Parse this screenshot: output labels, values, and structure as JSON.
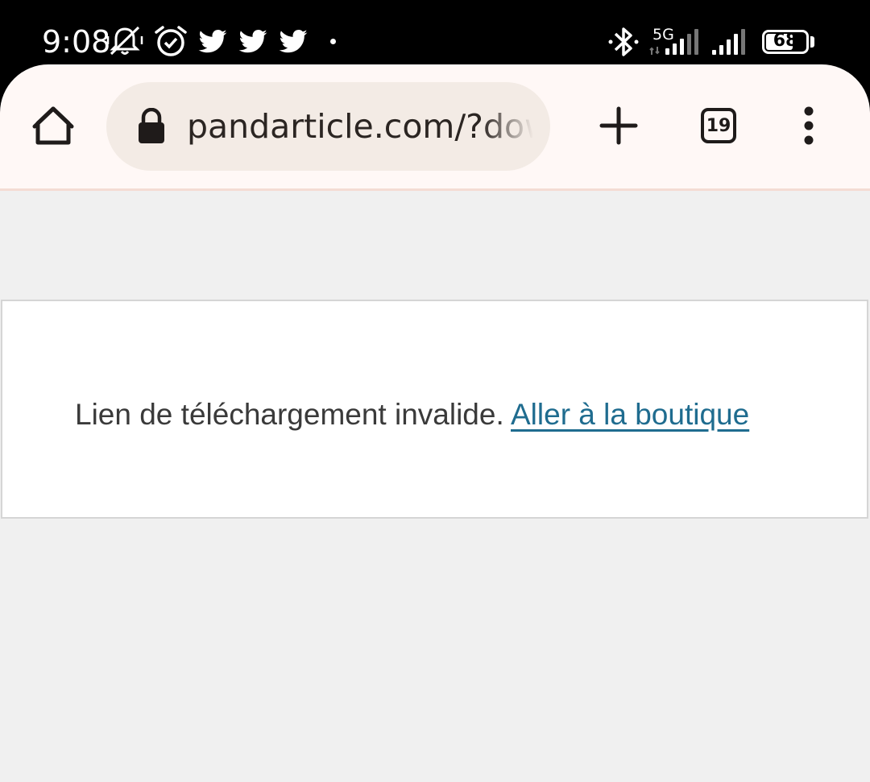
{
  "status_bar": {
    "time": "9:08",
    "network_label": "5G",
    "battery_level": "68",
    "battery_percent": 68,
    "icons": [
      "mute-icon",
      "alarm-icon",
      "twitter-icon",
      "twitter-icon",
      "twitter-icon",
      "notification-dot",
      "bluetooth-icon",
      "signal-icon",
      "signal-icon",
      "battery-icon"
    ]
  },
  "browser": {
    "url": "pandarticle.com/?dow",
    "tab_count": "19",
    "icons": {
      "home": "home-icon",
      "lock": "lock-icon",
      "new_tab": "plus-icon",
      "menu": "more-vert-icon"
    }
  },
  "page": {
    "message": "Lien de téléchargement invalide.",
    "link_label": "Aller à la boutique"
  },
  "colors": {
    "toolbar_bg": "#fff8f6",
    "url_bar_bg": "#f3ebe5",
    "page_bg": "#f0f0f0",
    "link": "#1f6c8f"
  }
}
